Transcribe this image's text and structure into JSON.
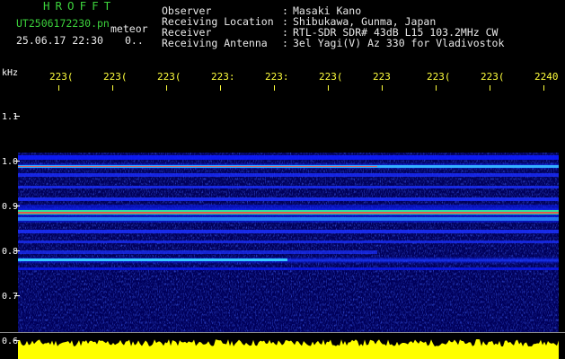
{
  "header": {
    "app_name": "HROFFT",
    "filename": "UT2506172230.pn",
    "mode_label": "meteor",
    "datetime": "25.06.17 22:30",
    "status_value": "0..",
    "info": [
      {
        "key": "Observer",
        "value": "Masaki Kano"
      },
      {
        "key": "Receiving Location",
        "value": "Shibukawa, Gunma, Japan"
      },
      {
        "key": "Receiver",
        "value": "RTL-SDR SDR# 43dB L15 103.2MHz CW"
      },
      {
        "key": "Receiving Antenna",
        "value": "3el Yagi(V) Az 330 for Vladivostok"
      }
    ]
  },
  "axis": {
    "unit": "kHz",
    "y_ticks": [
      "1.1",
      "1.0",
      "0.9",
      "0.8",
      "0.7",
      "0.6"
    ],
    "x_ticks": [
      "223(",
      "223(",
      "223(",
      "223:",
      "223:",
      "223(",
      "223",
      "223(",
      "223(",
      "2240"
    ]
  },
  "colors": {
    "background": "#000000",
    "header_green": "#3cd23c",
    "header_white": "#e8e8e8",
    "tick_yellow": "#ffff3c",
    "signal_yellow": "#ffff00"
  }
}
